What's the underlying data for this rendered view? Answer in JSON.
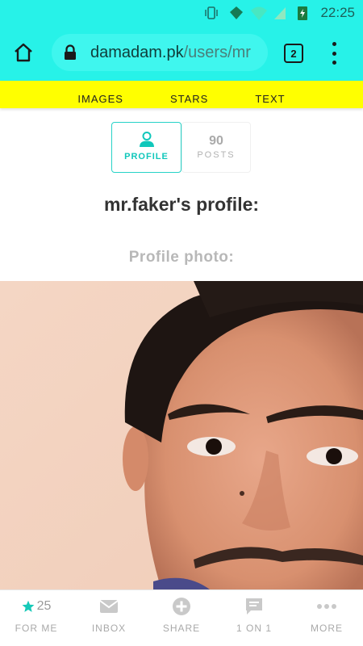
{
  "status_bar": {
    "time": "22:25"
  },
  "browser": {
    "url_domain": "damadam.pk",
    "url_path": "/users/mr",
    "tab_count": "2"
  },
  "top_nav": {
    "items": [
      "IMAGES",
      "STARS",
      "TEXT"
    ]
  },
  "profile_tabs": {
    "profile_label": "PROFILE",
    "posts_count": "90",
    "posts_label": "POSTS"
  },
  "page": {
    "title": "mr.faker's profile:",
    "photo_label": "Profile photo:"
  },
  "bottom_nav": {
    "for_me_count": "25",
    "items": [
      "FOR ME",
      "INBOX",
      "SHARE",
      "1 ON 1",
      "MORE"
    ]
  },
  "colors": {
    "accent": "#27f2e8",
    "nav_yellow": "#ffff00",
    "teal": "#10c7bb"
  }
}
